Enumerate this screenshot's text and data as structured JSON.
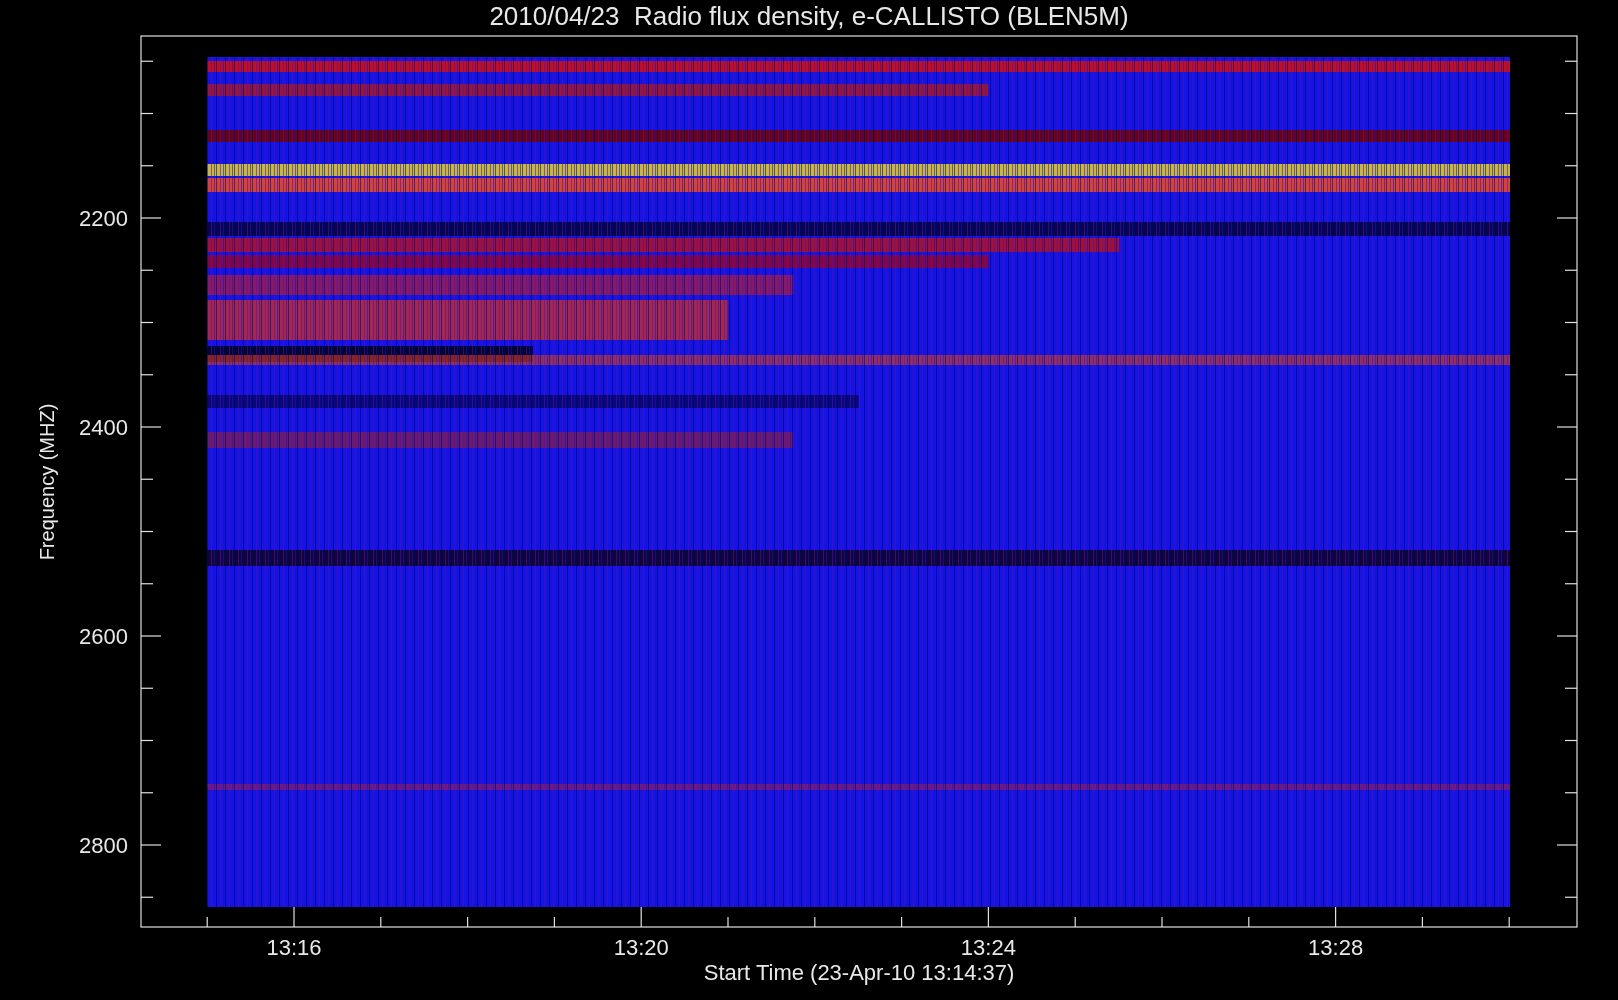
{
  "title": "2010/04/23  Radio flux density, e-CALLISTO (BLEN5M)",
  "ylabel": "Frequency (MHZ)",
  "xlabel": "Start Time (23-Apr-10 13:14:37)",
  "yticks": [
    "2200",
    "2400",
    "2600",
    "2800"
  ],
  "xticks": [
    "13:16",
    "13:20",
    "13:24",
    "13:28"
  ]
}
